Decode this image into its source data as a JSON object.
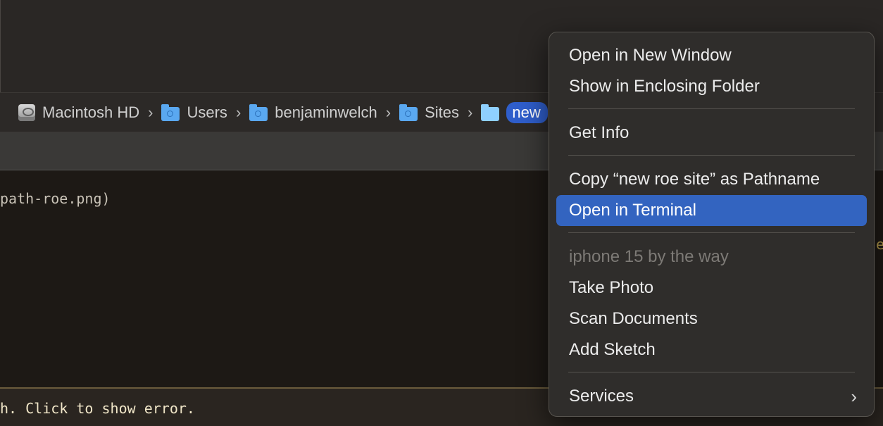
{
  "path_bar": {
    "crumbs": [
      {
        "label": "Macintosh HD",
        "icon": "hard-drive-icon"
      },
      {
        "label": "Users",
        "icon": "users-folder-icon"
      },
      {
        "label": "benjaminwelch",
        "icon": "home-folder-icon"
      },
      {
        "label": "Sites",
        "icon": "sites-folder-icon"
      },
      {
        "label": "new",
        "icon": "folder-icon"
      }
    ],
    "separator": "›"
  },
  "editor": {
    "visible_line": "path-roe.png)",
    "edge_glyph": "e"
  },
  "status_bar": {
    "message": "h. Click to show error."
  },
  "context_menu": {
    "items": [
      {
        "label": "Open in New Window",
        "state": "normal"
      },
      {
        "label": "Show in Enclosing Folder",
        "state": "normal"
      },
      {
        "label": "Get Info",
        "state": "normal"
      },
      {
        "label": "Copy “new roe site” as Pathname",
        "state": "normal"
      },
      {
        "label": "Open in Terminal",
        "state": "highlighted"
      },
      {
        "label": "iphone 15 by the way",
        "state": "disabled"
      },
      {
        "label": "Take Photo",
        "state": "normal"
      },
      {
        "label": "Scan Documents",
        "state": "normal"
      },
      {
        "label": "Add Sketch",
        "state": "normal"
      },
      {
        "label": "Services",
        "state": "normal"
      }
    ],
    "submenu_indicator": "›"
  },
  "colors": {
    "highlight": "#3364c0",
    "folder_blue": "#5aa8f0",
    "selected_crumb": "#2f5ecb"
  }
}
